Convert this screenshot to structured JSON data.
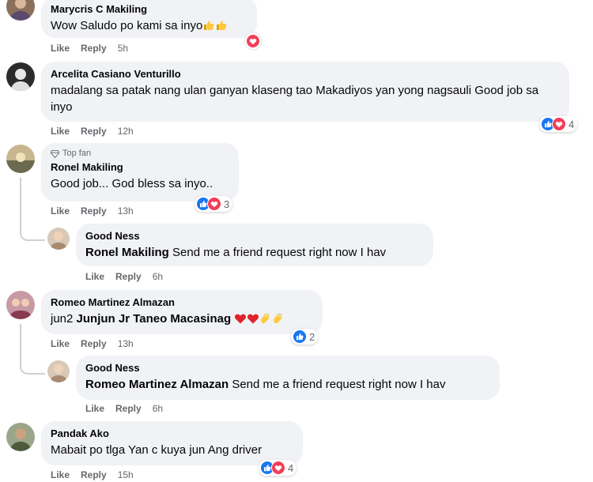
{
  "comments": [
    {
      "name": "Marycris C Makiling",
      "text": "Wow Saludo po kami sa inyo",
      "like": "Like",
      "reply": "Reply",
      "time": "5h"
    },
    {
      "name": "Arcelita Casiano Venturillo",
      "text": "madalang sa patak nang ulan ganyan klaseng tao Makadiyos yan yong nagsauli Good job sa inyo",
      "like": "Like",
      "reply": "Reply",
      "time": "12h",
      "reaction_count": "4"
    },
    {
      "badge": "Top fan",
      "name": "Ronel Makiling",
      "text": "Good job... God bless sa inyo..",
      "like": "Like",
      "reply": "Reply",
      "time": "13h",
      "reaction_count": "3",
      "reply_item": {
        "name": "Good Ness",
        "tag": "Ronel Makiling",
        "text": "Send me a friend request right now I hav",
        "like": "Like",
        "reply": "Reply",
        "time": "6h"
      }
    },
    {
      "name": "Romeo Martinez Almazan",
      "prefix": "jun2",
      "tag": "Junjun Jr Taneo Macasinag",
      "like": "Like",
      "reply": "Reply",
      "time": "13h",
      "reaction_count": "2",
      "reply_item": {
        "name": "Good Ness",
        "tag": "Romeo Martinez Almazan",
        "text": "Send me a friend request right now I hav",
        "like": "Like",
        "reply": "Reply",
        "time": "6h"
      }
    },
    {
      "name": "Pandak Ako",
      "text": "Mabait po tlga Yan c kuya jun Ang driver",
      "like": "Like",
      "reply": "Reply",
      "time": "15h",
      "reaction_count": "4"
    }
  ],
  "colors": {
    "bubble": "#f0f2f5",
    "like_blue": "#1877f2",
    "love_red": "#f33e58",
    "meta_gray": "#65676b"
  },
  "icons": [
    "like-reaction-icon",
    "love-reaction-icon",
    "thumbs-up-emoji-icon",
    "red-heart-emoji-icon",
    "clapping-hands-emoji-icon",
    "diamond-icon"
  ]
}
